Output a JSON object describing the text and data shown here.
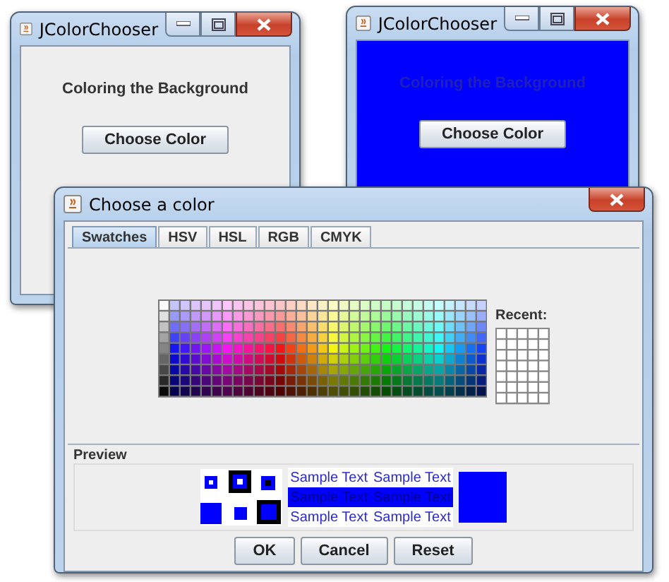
{
  "windows": [
    {
      "title": "JColorChooser",
      "label": "Coloring the Background",
      "button": "Choose Color",
      "color": "#eeeeee"
    },
    {
      "title": "JColorChooser",
      "label": "Coloring the Background",
      "button": "Choose Color",
      "color": "#0000ff"
    }
  ],
  "dialog": {
    "title": "Choose a color",
    "tabs": [
      {
        "label": "Swatches",
        "selected": true
      },
      {
        "label": "HSV",
        "selected": false
      },
      {
        "label": "HSL",
        "selected": false
      },
      {
        "label": "RGB",
        "selected": false
      },
      {
        "label": "CMYK",
        "selected": false
      }
    ],
    "recent_label": "Recent:",
    "preview_label": "Preview",
    "preview_rows": [
      [
        "Sample Text",
        "Sample Text"
      ],
      [
        "Sample Text",
        "Sample Text"
      ],
      [
        "Sample Text",
        "Sample Text"
      ]
    ],
    "buttons": [
      {
        "label": "OK"
      },
      {
        "label": "Cancel"
      },
      {
        "label": "Reset"
      }
    ]
  }
}
